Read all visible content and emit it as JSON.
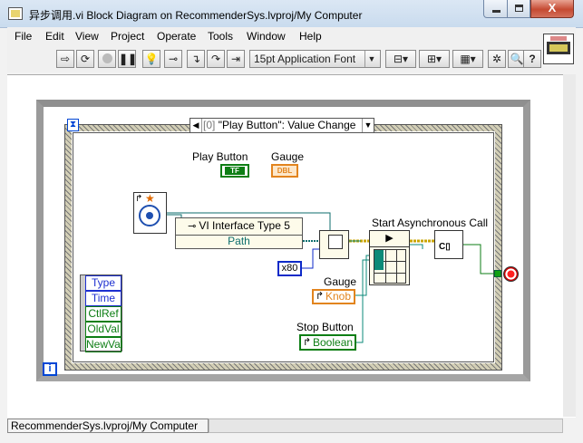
{
  "window": {
    "title": "异步调用.vi Block Diagram on RecommenderSys.lvproj/My Computer",
    "buttons": {
      "minimize": "",
      "maximize": "",
      "close": "X"
    }
  },
  "menu": {
    "items": [
      "File",
      "Edit",
      "View",
      "Project",
      "Operate",
      "Tools",
      "Window",
      "Help"
    ]
  },
  "toolbar": {
    "font_select": "15pt Application Font",
    "icons": [
      "run-arrow-icon",
      "run-continuously-icon",
      "abort-icon",
      "pause-icon",
      "highlight-execution-icon",
      "retain-wire-values-icon",
      "step-into-icon",
      "step-over-icon",
      "step-out-icon",
      "align-icon",
      "distribute-icon",
      "reorder-icon",
      "cleanup-icon",
      "search-icon",
      "help-icon"
    ]
  },
  "diagram": {
    "event_structure": {
      "case_index": "[0]",
      "case_name": "\"Play Button\": Value Change",
      "event_data_fields": [
        "Type",
        "Time",
        "CtlRef",
        "OldVal",
        "NewVal"
      ],
      "field_colors": [
        "#1d2fd0",
        "#1d2fd0",
        "#0d7e14",
        "#0d7e14",
        "#0d7e14"
      ]
    },
    "labels": {
      "play_button": "Play Button",
      "gauge_top": "Gauge",
      "start_async": "Start Asynchronous Call",
      "gauge": "Gauge",
      "stop_button": "Stop Button"
    },
    "terminals": {
      "play_button": "TF",
      "gauge_top": "DBL",
      "knob": "Knob",
      "boolean": "Boolean"
    },
    "type_specifier": {
      "name": "VI Interface Type 5",
      "output": "Path"
    },
    "constant_80": "x80",
    "while_loop_iteration": "i",
    "event_timeout_icon": "hourglass-icon"
  },
  "status": {
    "context": "RecommenderSys.lvproj/My Computer"
  }
}
